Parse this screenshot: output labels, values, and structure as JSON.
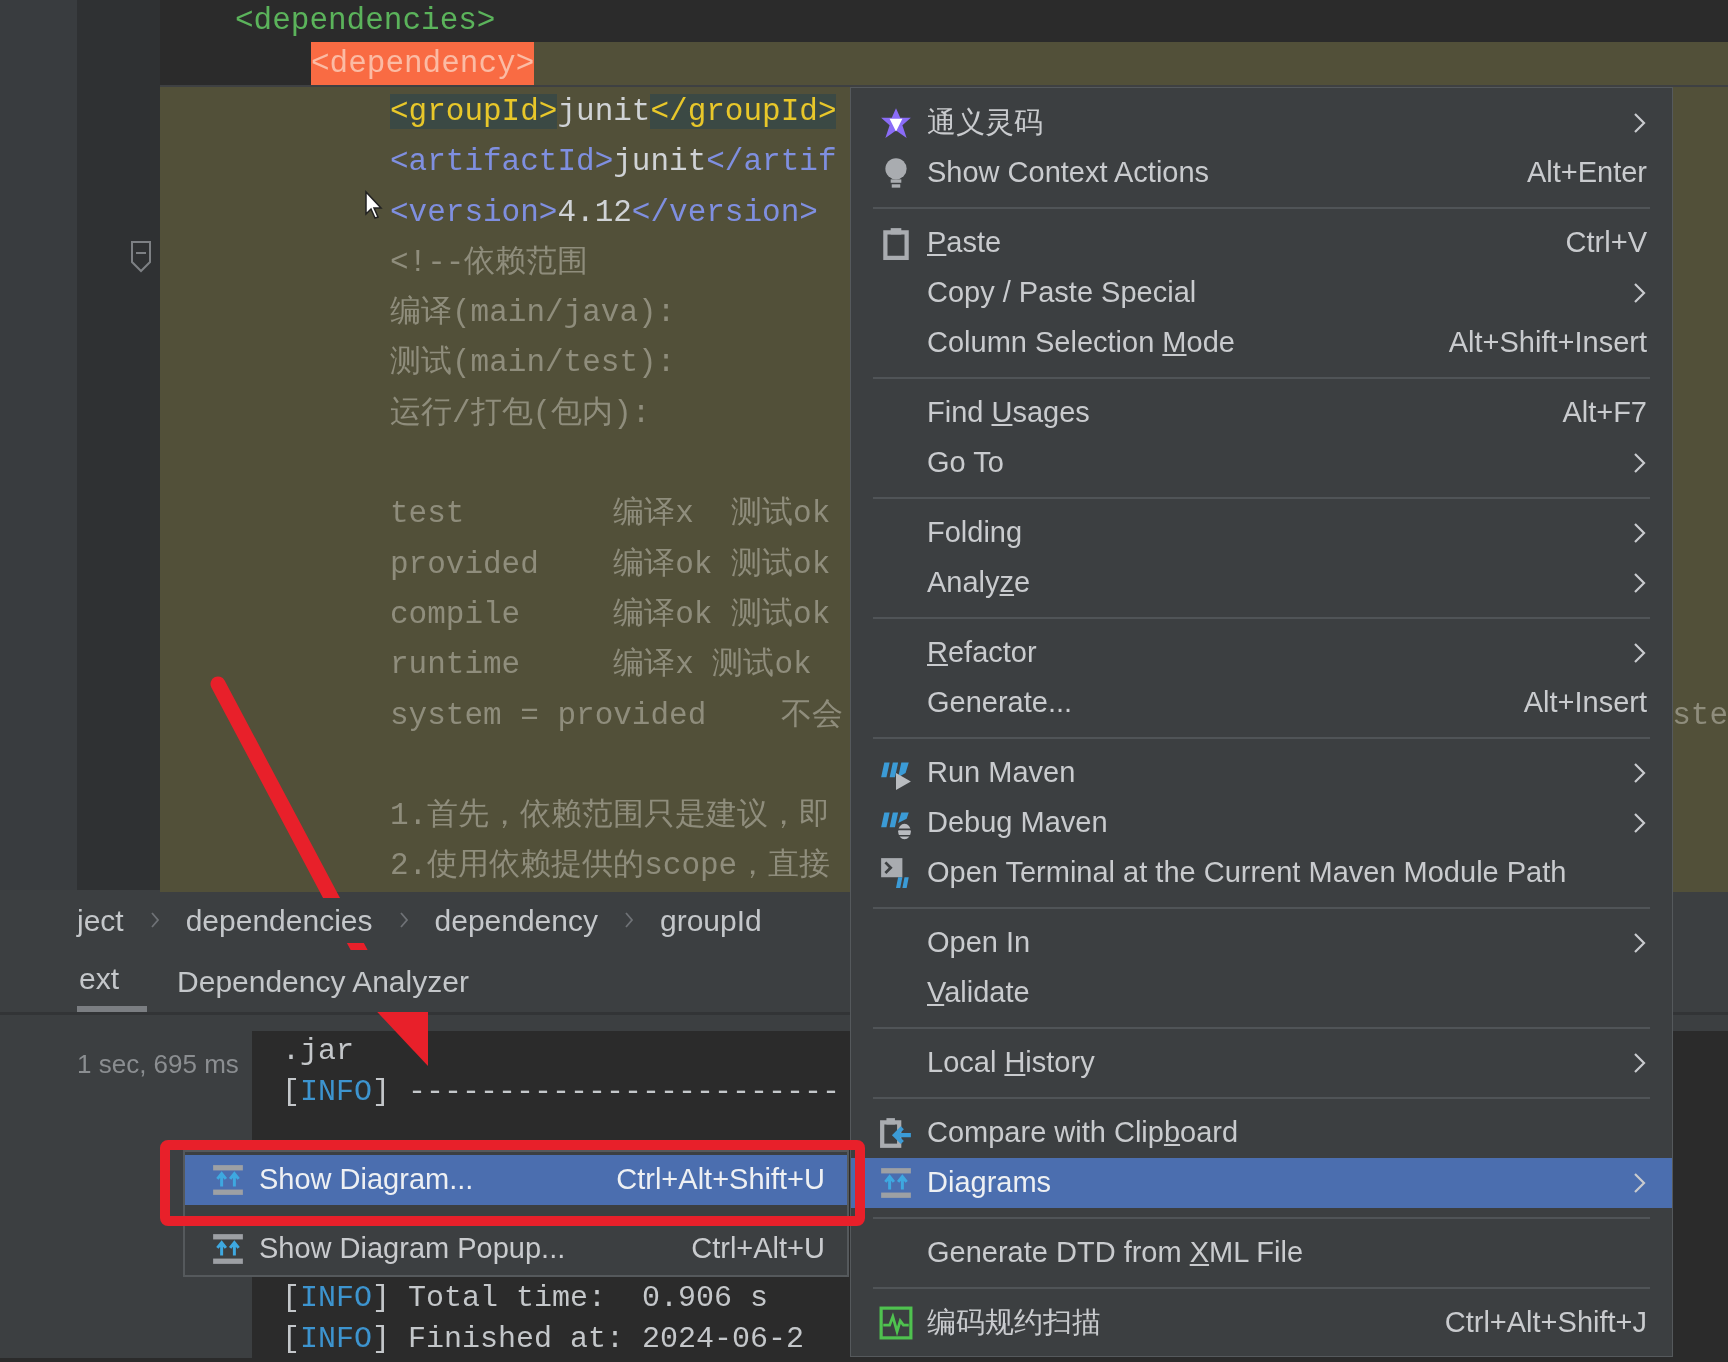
{
  "editor": {
    "sticky_lines": [
      {
        "segments": [
          {
            "text": "<dependencies>",
            "kind": "outer_tag"
          }
        ],
        "children": [
          {
            "segments": [
              {
                "text": "<dependency>",
                "kind": "current_tag"
              }
            ]
          }
        ]
      }
    ],
    "lines": [
      {
        "kind": "code",
        "segments": [
          {
            "text": "<groupId>",
            "kind": "match_tag"
          },
          {
            "text": "junit",
            "kind": "text"
          },
          {
            "text": "</groupId>",
            "kind": "match_tag"
          }
        ]
      },
      {
        "kind": "code",
        "segments": [
          {
            "text": "<artifactId>",
            "kind": "tag"
          },
          {
            "text": "junit",
            "kind": "text"
          },
          {
            "text": "</artif",
            "kind": "tag"
          }
        ]
      },
      {
        "kind": "code",
        "segments": [
          {
            "text": "<version>",
            "kind": "tag"
          },
          {
            "text": "4.12",
            "kind": "text"
          },
          {
            "text": "</version>",
            "kind": "tag"
          }
        ]
      },
      {
        "kind": "code",
        "segments": [
          {
            "text": "<!--依赖范围",
            "kind": "comment"
          }
        ]
      },
      {
        "kind": "code",
        "segments": [
          {
            "text": "编译(main/java):",
            "kind": "comment"
          }
        ]
      },
      {
        "kind": "code",
        "segments": [
          {
            "text": "测试(main/test):",
            "kind": "comment"
          }
        ]
      },
      {
        "kind": "code",
        "segments": [
          {
            "text": "运行/打包(包内):",
            "kind": "comment"
          }
        ]
      },
      {
        "kind": "blank"
      },
      {
        "kind": "code",
        "segments": [
          {
            "text": "test        编译x  测试ok",
            "kind": "comment"
          }
        ]
      },
      {
        "kind": "code",
        "segments": [
          {
            "text": "provided    编译ok 测试ok",
            "kind": "comment"
          }
        ]
      },
      {
        "kind": "code",
        "segments": [
          {
            "text": "compile     编译ok 测试ok",
            "kind": "comment"
          }
        ]
      },
      {
        "kind": "code",
        "segments": [
          {
            "text": "runtime     编译x 测试ok",
            "kind": "comment"
          }
        ]
      },
      {
        "kind": "code",
        "segments": [
          {
            "text": "system = provided    不会",
            "kind": "comment"
          }
        ],
        "tail": "ste"
      },
      {
        "kind": "blank"
      },
      {
        "kind": "code",
        "segments": [
          {
            "text": "1.首先，依赖范围只是建议，即",
            "kind": "comment"
          }
        ]
      },
      {
        "kind": "code",
        "segments": [
          {
            "text": "2.使用依赖提供的scope，直接",
            "kind": "comment"
          }
        ]
      }
    ]
  },
  "breadcrumbs": [
    "ject",
    "dependencies",
    "dependency",
    "groupId"
  ],
  "tabs": [
    {
      "label": "ext",
      "selected": true
    },
    {
      "label": "Dependency Analyzer",
      "selected": false
    }
  ],
  "run_panel": {
    "duration": "1 sec, 695 ms"
  },
  "console": {
    "lines_top": [
      [
        {
          "text": ".jar",
          "kind": "plain"
        }
      ],
      [
        {
          "text": "[",
          "kind": "plain"
        },
        {
          "text": "INFO",
          "kind": "level"
        },
        {
          "text": "] ------------------------",
          "kind": "plain"
        }
      ]
    ],
    "lines_bottom": [
      [
        {
          "text": "[",
          "kind": "plain"
        },
        {
          "text": "INFO",
          "kind": "level"
        },
        {
          "text": "] Total time:  0.906 s",
          "kind": "plain"
        }
      ],
      [
        {
          "text": "[",
          "kind": "plain"
        },
        {
          "text": "INFO",
          "kind": "level"
        },
        {
          "text": "] Finished at: 2024-06-2",
          "kind": "plain"
        }
      ]
    ]
  },
  "context_menu": {
    "items": [
      {
        "kind": "plugin",
        "label": "通义灵码",
        "submenu": true,
        "selected": false
      },
      {
        "kind": "intention",
        "label": "Show Context Actions",
        "shortcut": "Alt+Enter",
        "submenu": false,
        "selected": false
      },
      {
        "kind": "separator"
      },
      {
        "kind": "paste",
        "label": {
          "key": "P",
          "post": "aste"
        },
        "shortcut": "Ctrl+V",
        "submenu": false,
        "selected": false
      },
      {
        "kind": "plain",
        "label": "Copy / Paste Special",
        "submenu": true,
        "selected": false
      },
      {
        "kind": "plain",
        "label": {
          "pre": "Column Selection ",
          "key": "M",
          "post": "ode"
        },
        "shortcut": "Alt+Shift+Insert",
        "submenu": false,
        "selected": false
      },
      {
        "kind": "separator"
      },
      {
        "kind": "plain",
        "label": {
          "pre": "Find ",
          "key": "U",
          "post": "sages"
        },
        "shortcut": "Alt+F7",
        "submenu": false,
        "selected": false
      },
      {
        "kind": "plain",
        "label": "Go To",
        "submenu": true,
        "selected": false
      },
      {
        "kind": "separator"
      },
      {
        "kind": "plain",
        "label": "Folding",
        "submenu": true,
        "selected": false
      },
      {
        "kind": "plain",
        "label": {
          "pre": "Analy",
          "key": "z",
          "post": "e"
        },
        "submenu": true,
        "selected": false
      },
      {
        "kind": "separator"
      },
      {
        "kind": "plain",
        "label": {
          "key": "R",
          "post": "efactor"
        },
        "submenu": true,
        "selected": false
      },
      {
        "kind": "plain",
        "label": "Generate...",
        "shortcut": "Alt+Insert",
        "submenu": false,
        "selected": false
      },
      {
        "kind": "separator"
      },
      {
        "kind": "run",
        "label": "Run Maven",
        "submenu": true,
        "selected": false
      },
      {
        "kind": "debug",
        "label": "Debug Maven",
        "submenu": true,
        "selected": false
      },
      {
        "kind": "terminal",
        "label": "Open Terminal at the Current Maven Module Path",
        "submenu": false,
        "selected": false
      },
      {
        "kind": "separator"
      },
      {
        "kind": "plain",
        "label": "Open In",
        "submenu": true,
        "selected": false
      },
      {
        "kind": "plain",
        "label": {
          "key": "V",
          "post": "alidate"
        },
        "submenu": false,
        "selected": false
      },
      {
        "kind": "separator"
      },
      {
        "kind": "plain",
        "label": {
          "pre": "Local ",
          "key": "H",
          "post": "istory"
        },
        "submenu": true,
        "selected": false
      },
      {
        "kind": "separator"
      },
      {
        "kind": "compare",
        "label": {
          "pre": "Compare with Clip",
          "key": "b",
          "post": "oard"
        },
        "submenu": false,
        "selected": false
      },
      {
        "kind": "diagram",
        "label": "Diagrams",
        "submenu": true,
        "selected": true
      },
      {
        "kind": "separator"
      },
      {
        "kind": "plain",
        "label": {
          "pre": "Generate DTD from ",
          "key": "X",
          "post": "ML File"
        },
        "submenu": false,
        "selected": false
      },
      {
        "kind": "separator"
      },
      {
        "kind": "scan",
        "label": "编码规约扫描",
        "shortcut": "Ctrl+Alt+Shift+J",
        "submenu": false,
        "selected": false
      }
    ]
  },
  "submenu": {
    "items": [
      {
        "kind": "diagram",
        "label": "Show Diagram...",
        "shortcut": "Ctrl+Alt+Shift+U",
        "selected": true
      },
      {
        "kind": "diagram",
        "label": "Show Diagram Popup...",
        "shortcut": "Ctrl+Alt+U",
        "selected": false
      }
    ]
  }
}
